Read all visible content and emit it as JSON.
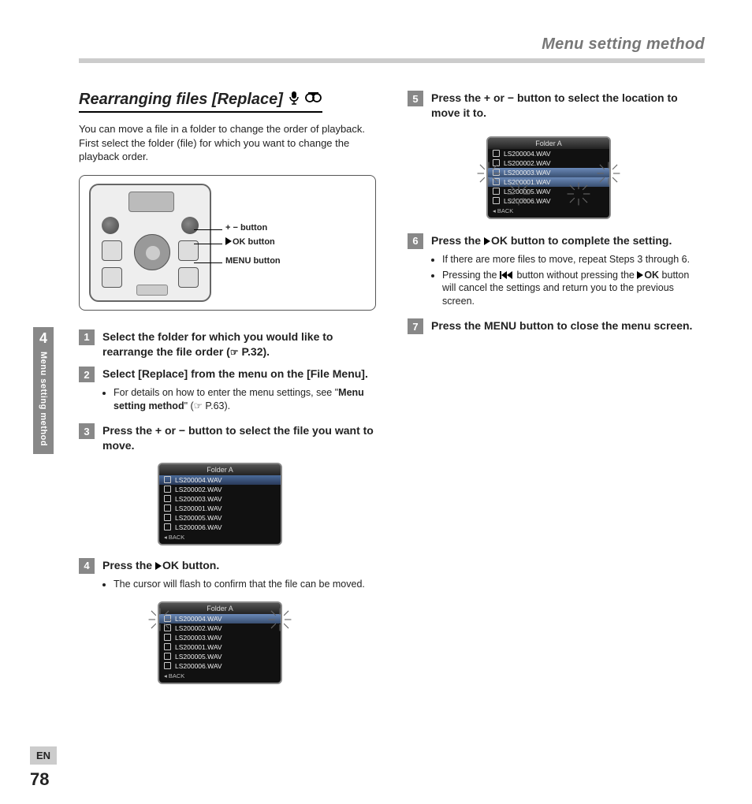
{
  "header": {
    "title": "Menu setting method"
  },
  "section": {
    "title": "Rearranging files [Replace]",
    "intro": "You can move a file in a folder to change the order of playback. First select the folder (file) for which you want to change the playback order."
  },
  "device_labels": {
    "plus_minus": "+ − button",
    "ok": "OK button",
    "menu": "MENU button"
  },
  "steps": {
    "s1": {
      "num": "1",
      "head_a": "Select the folder for which you would like to rearrange the file order (",
      "head_b": " P.32)."
    },
    "s2": {
      "num": "2",
      "head_a": "Select [",
      "head_b": "Replace",
      "head_c": "] from the menu on the [",
      "head_d": "File Menu",
      "head_e": "].",
      "bullet_a": "For details on how to enter the menu settings, see \"",
      "bullet_b": "Menu setting method",
      "bullet_c": "\" (",
      "bullet_d": " P.63)."
    },
    "s3": {
      "num": "3",
      "head": "Press the + or − button to select the file you want to move."
    },
    "s4": {
      "num": "4",
      "head_a": "Press the ",
      "head_b": "OK button.",
      "bullet": "The cursor will flash to confirm that the file can be moved."
    },
    "s5": {
      "num": "5",
      "head": "Press the + or − button to select the location to move it to."
    },
    "s6": {
      "num": "6",
      "head_a": "Press the ",
      "head_b": "OK button to complete the setting.",
      "bullet1": "If there are more files to move, repeat Steps 3 through 6.",
      "bullet2_a": "Pressing the ",
      "bullet2_b": " button without pressing the ",
      "bullet2_c": "OK",
      "bullet2_d": " button will cancel the settings and return you to the previous screen."
    },
    "s7": {
      "num": "7",
      "head_a": "Press the ",
      "head_b": "MENU",
      "head_c": " button to close the menu screen."
    }
  },
  "screens": {
    "folder_title": "Folder A",
    "files": [
      "LS200004.WAV",
      "LS200002.WAV",
      "LS200003.WAV",
      "LS200001.WAV",
      "LS200005.WAV",
      "LS200006.WAV"
    ],
    "files_b": [
      "LS200004.WAV",
      "LS200002.WAV",
      "LS200003.WAV",
      "LS200001.WAV",
      "LS200005.WAV",
      "LS200006.WAV"
    ],
    "files_c": [
      "LS200004.WAV",
      "LS200002.WAV",
      "LS200003.WAV",
      "LS200001.WAV",
      "LS200005.WAV",
      "LS200006.WAV"
    ],
    "back": "BACK"
  },
  "chapter": {
    "num": "4",
    "label": "Menu setting method"
  },
  "footer": {
    "lang": "EN",
    "page": "78"
  },
  "glyphs": {
    "pointer": "☞"
  }
}
